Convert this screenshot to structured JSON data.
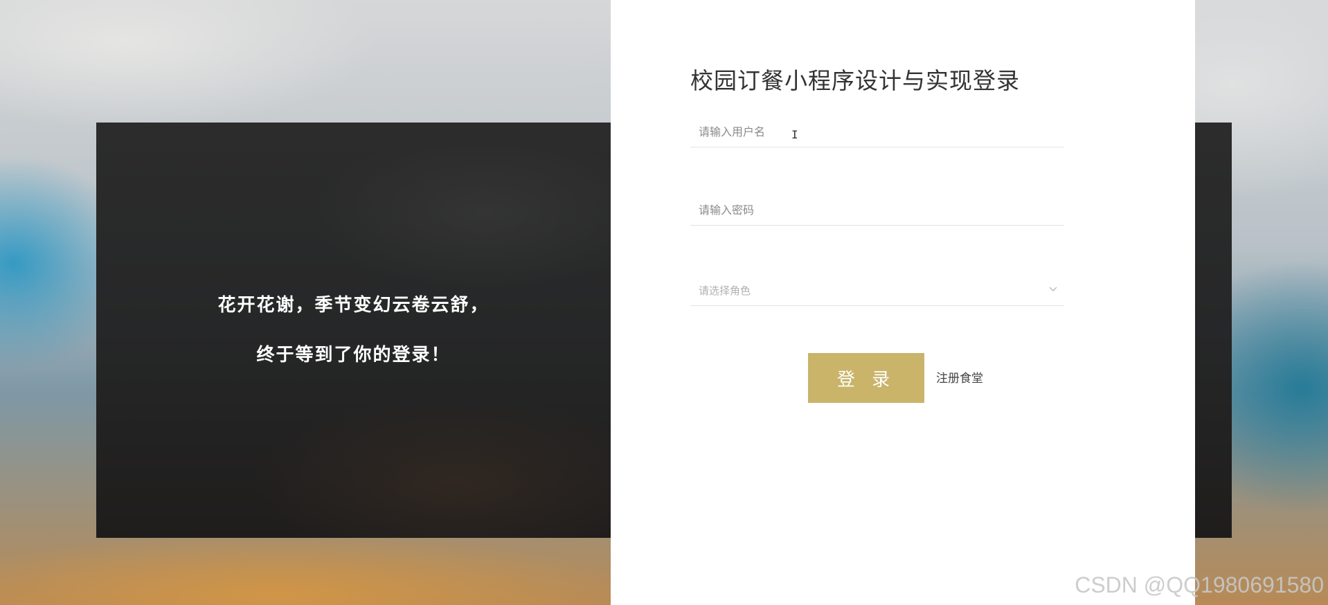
{
  "slogan": {
    "line1": "花开花谢，季节变幻云卷云舒，",
    "line2": "终于等到了你的登录！"
  },
  "login": {
    "title": "校园订餐小程序设计与实现登录",
    "username_placeholder": "请输入用户名",
    "password_placeholder": "请输入密码",
    "role_placeholder": "请选择角色",
    "login_button": "登 录",
    "register_link": "注册食堂"
  },
  "watermark": "CSDN @QQ1980691580",
  "colors": {
    "accent": "#c9b46a",
    "card": "#ffffff",
    "panel": "#262728"
  },
  "icons": {
    "role_dropdown": "chevron-down-icon",
    "text_cursor": "text-cursor-icon"
  }
}
